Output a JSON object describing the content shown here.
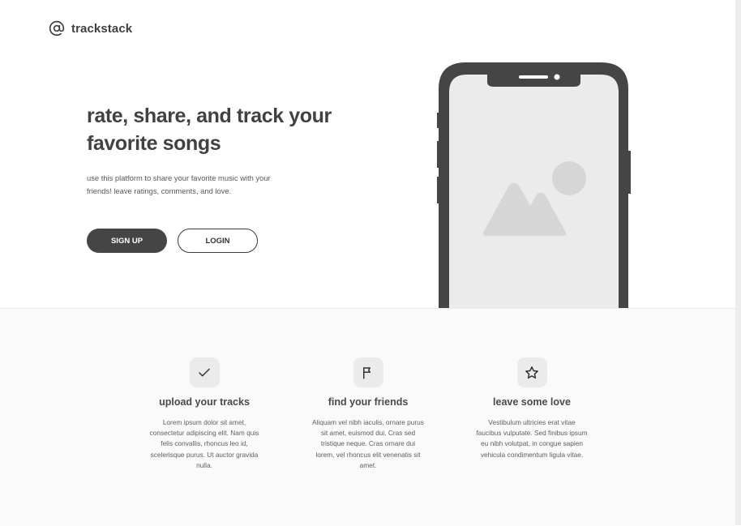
{
  "brand": {
    "name": "trackstack",
    "icon": "at-sign-icon"
  },
  "hero": {
    "title": "rate, share, and track your favorite songs",
    "subtitle": "use this platform to share your favorite music with your friends! leave ratings, comments, and love.",
    "signup_label": "SIGN UP",
    "login_label": "LOGIN",
    "image_icon": "image-placeholder-icon"
  },
  "features": [
    {
      "icon": "check-icon",
      "title": "upload your tracks",
      "text": "Lorem ipsum dolor sit amet, consectetur adipiscing elit. Nam quis felis convallis, rhoncus leo id, scelerisque purus. Ut auctor gravida nulla."
    },
    {
      "icon": "flag-icon",
      "title": "find your friends",
      "text": "Aliquam vel nibh iaculis, ornare purus sit amet, euismod dui. Cras sed tristique neque. Cras ornare dui lorem, vel rhoncus elit venenatis sit amet."
    },
    {
      "icon": "star-icon",
      "title": "leave some love",
      "text": "Vestibulum ultricies erat vitae faucibus vulputate. Sed finibus ipsum eu nibh volutpat, in congue sapien vehicula condimentum ligula vitae."
    }
  ],
  "colors": {
    "primary_dark": "#454545",
    "text": "#414141",
    "screen_bg": "#ebebeb",
    "placeholder": "#d6d6d6"
  }
}
